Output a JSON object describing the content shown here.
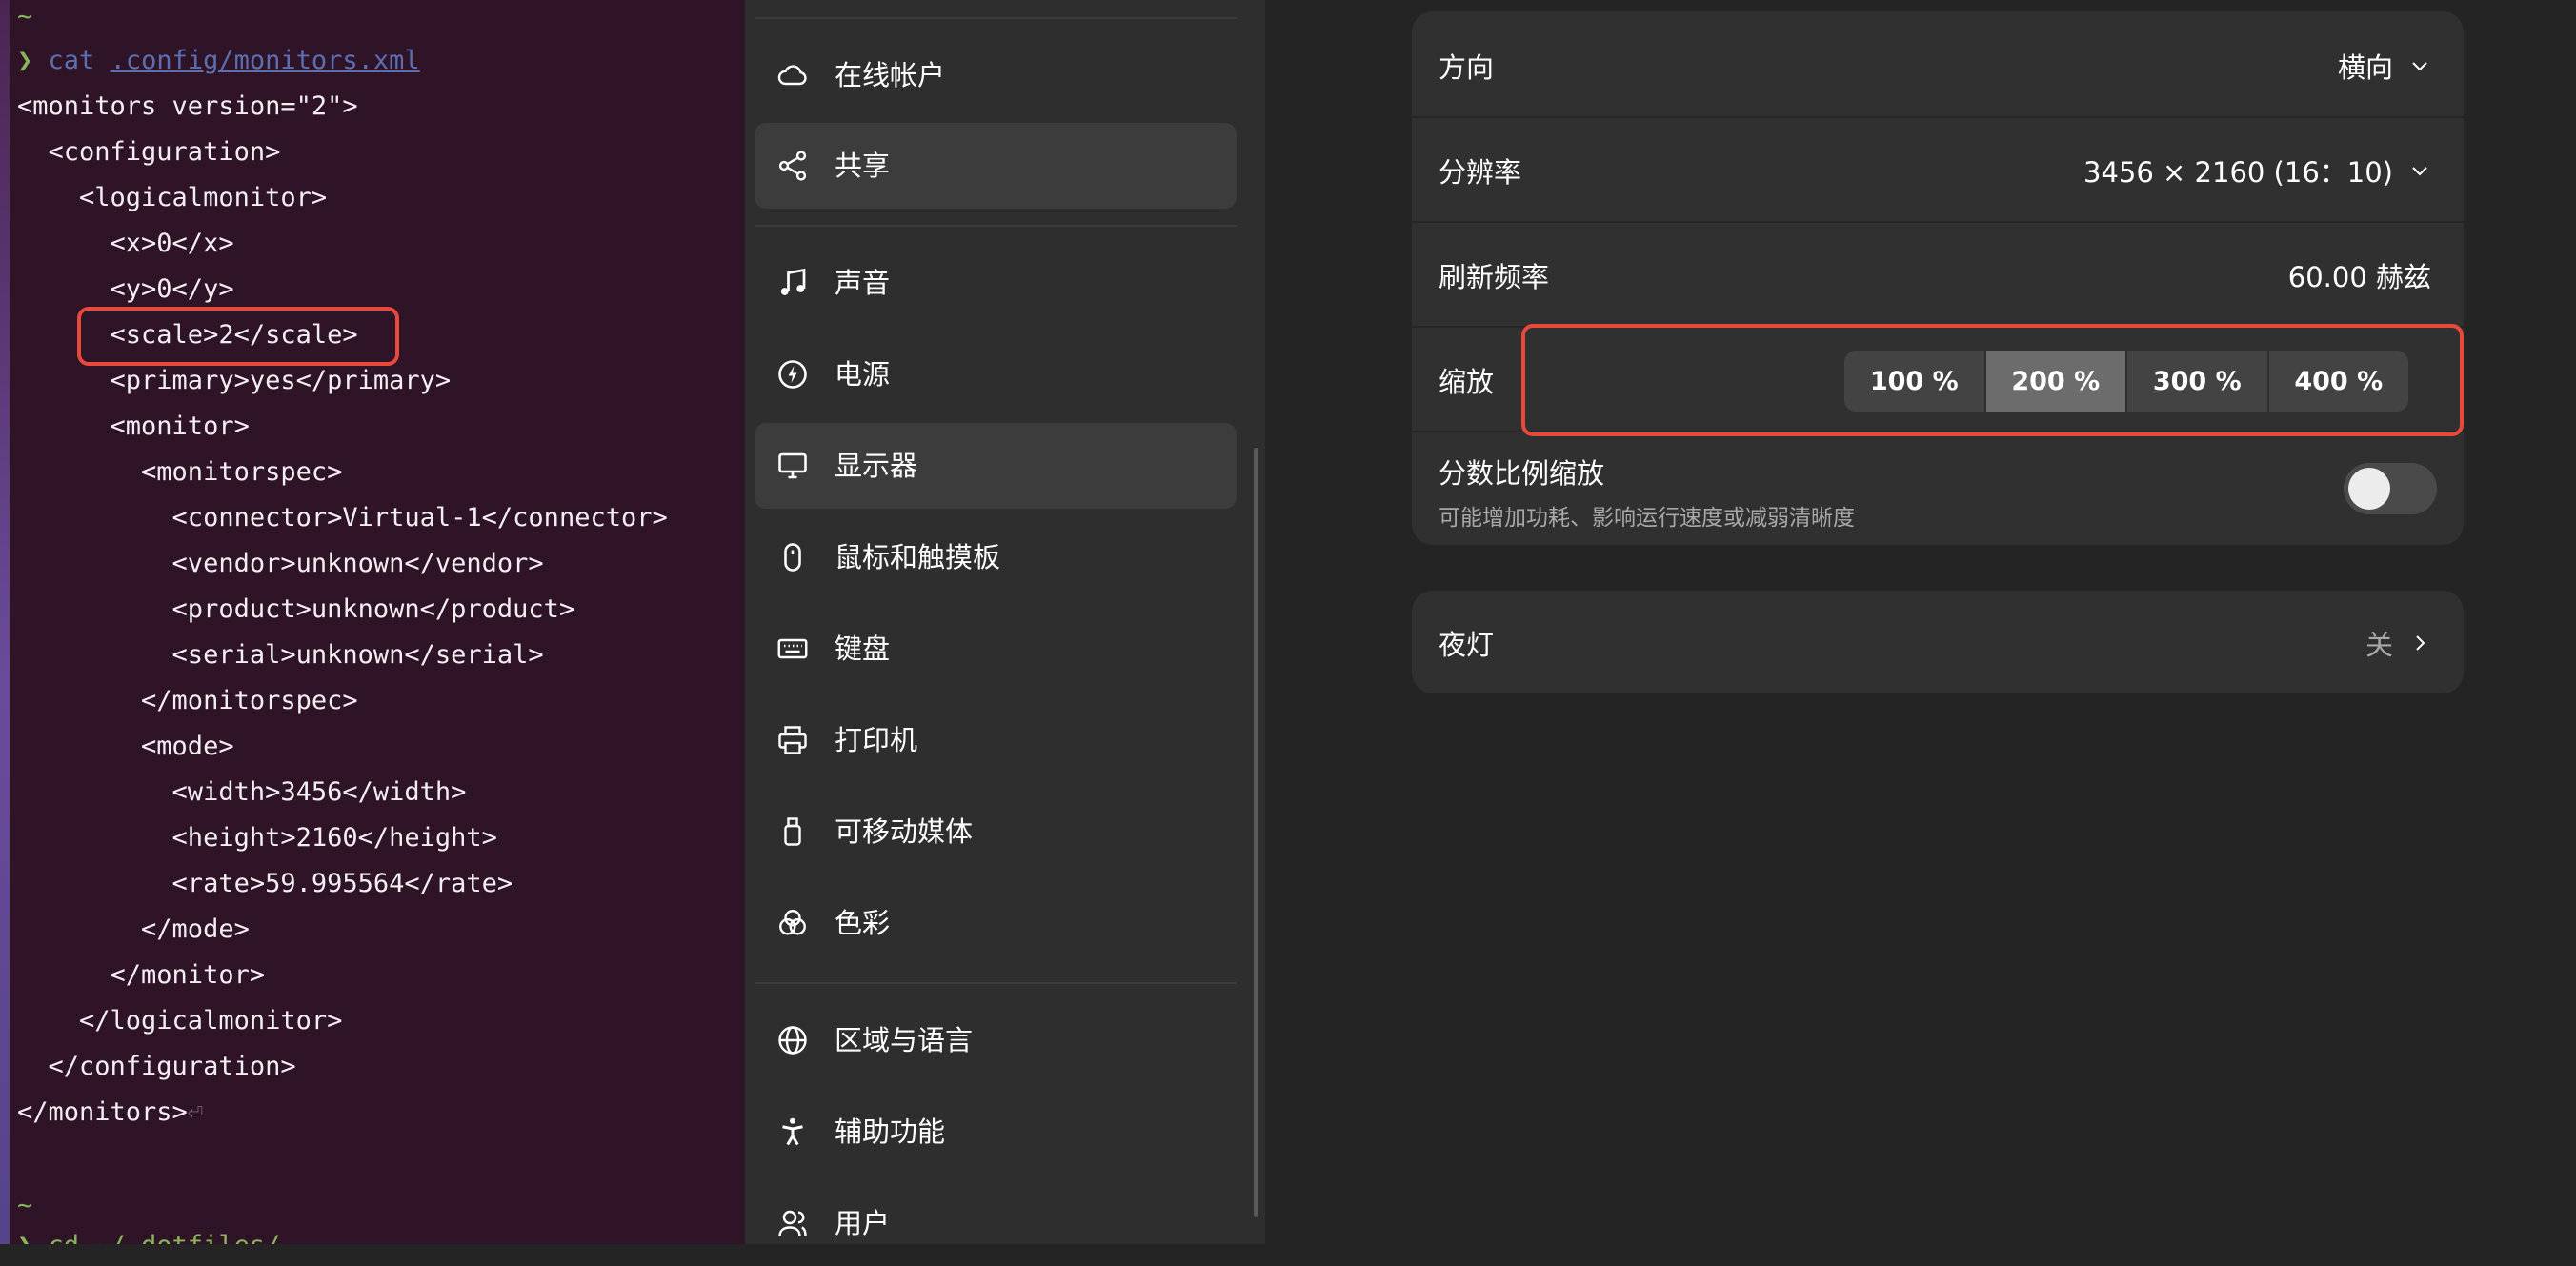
{
  "terminal": {
    "lines": [
      "~",
      "",
      "<monitors version=\"2\">",
      "  <configuration>",
      "    <logicalmonitor>",
      "      <x>0</x>",
      "      <y>0</y>",
      "      <scale>2</scale>",
      "      <primary>yes</primary>",
      "      <monitor>",
      "        <monitorspec>",
      "          <connector>Virtual-1</connector>",
      "          <vendor>unknown</vendor>",
      "          <product>unknown</product>",
      "          <serial>unknown</serial>",
      "        </monitorspec>",
      "        <mode>",
      "          <width>3456</width>",
      "          <height>2160</height>",
      "          <rate>59.995564</rate>",
      "        </mode>",
      "      </monitor>",
      "    </logicalmonitor>",
      "  </configuration>",
      "</monitors>",
      "~"
    ],
    "prompt_symbol": "❯",
    "command": "cat",
    "command_arg": ".config/monitors.xml",
    "return_glyph": "⏎",
    "cut_off_line": "❯ cd ~/.dotfiles/"
  },
  "sidebar": {
    "items": [
      {
        "label": "在线帐户",
        "icon": "cloud-icon"
      },
      {
        "label": "共享",
        "icon": "share-icon"
      },
      {
        "label": "声音",
        "icon": "music-note-icon"
      },
      {
        "label": "电源",
        "icon": "power-icon"
      },
      {
        "label": "显示器",
        "icon": "monitor-icon"
      },
      {
        "label": "鼠标和触摸板",
        "icon": "mouse-icon"
      },
      {
        "label": "键盘",
        "icon": "keyboard-icon"
      },
      {
        "label": "打印机",
        "icon": "printer-icon"
      },
      {
        "label": "可移动媒体",
        "icon": "usb-drive-icon"
      },
      {
        "label": "色彩",
        "icon": "color-circles-icon"
      },
      {
        "label": "区域与语言",
        "icon": "globe-icon"
      },
      {
        "label": "辅助功能",
        "icon": "accessibility-icon"
      },
      {
        "label": "用户",
        "icon": "users-icon"
      }
    ]
  },
  "display": {
    "orientation": {
      "label": "方向",
      "value": "横向"
    },
    "resolution": {
      "label": "分辨率",
      "value": "3456 × 2160 (16：10)"
    },
    "refresh_rate": {
      "label": "刷新频率",
      "value": "60.00 赫兹"
    },
    "scale": {
      "label": "缩放",
      "options": [
        "100 %",
        "200 %",
        "300 %",
        "400 %"
      ],
      "selected": "200 %"
    },
    "fractional_scaling": {
      "label": "分数比例缩放",
      "description": "可能增加功耗、影响运行速度或减弱清晰度",
      "enabled": false
    }
  },
  "night_light": {
    "label": "夜灯",
    "value": "关"
  },
  "colors": {
    "highlight": "#e8493a",
    "terminal_bg": "#2f1327",
    "sidebar_bg": "#2e2e2e",
    "panel_bg": "#242424",
    "card_bg": "#303030"
  }
}
